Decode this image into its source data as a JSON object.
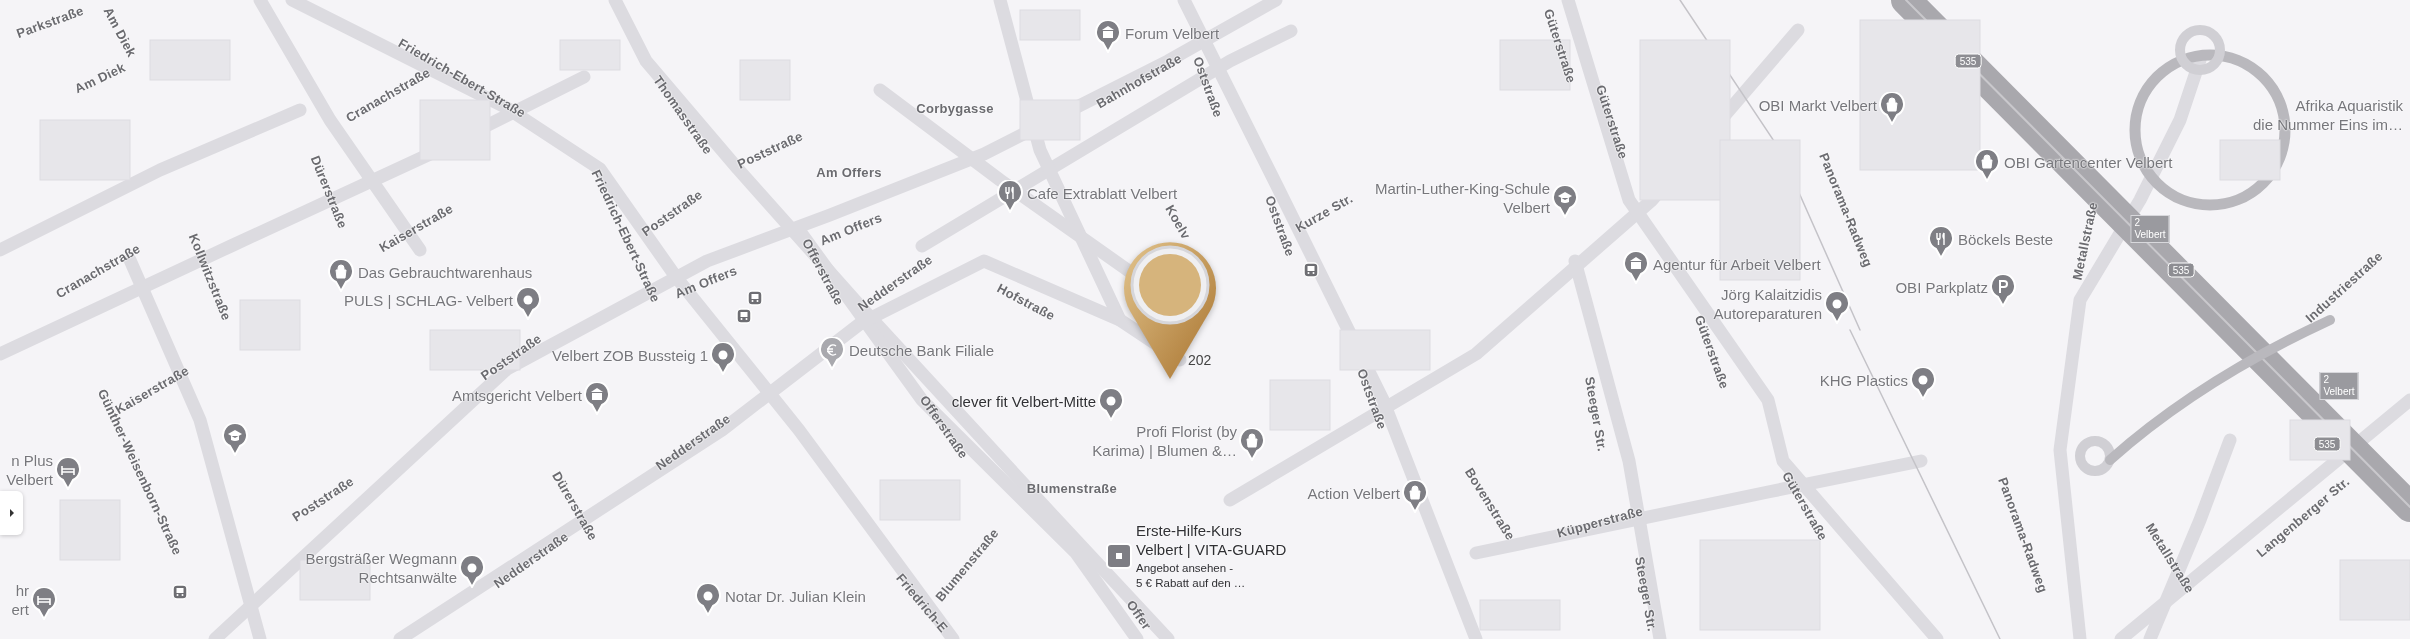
{
  "map": {
    "street_labels": [
      "Parkstraße",
      "Am Diek",
      "Am Diek",
      "Friedrich-Ebert-Straße",
      "Cranachstraße",
      "Cranachstraße",
      "Dürerstraße",
      "Kaiserstraße",
      "Kollwitzstraße",
      "Thomasstraße",
      "Poststraße",
      "Poststraße",
      "Friedrich-Ebert-Straße",
      "Am Offers",
      "Am Offers",
      "Am Offers",
      "Offerstraße",
      "Nedderstraße",
      "Hofstraße",
      "Koelv",
      "Bahnhofstraße",
      "Corbygasse",
      "Oststraße",
      "Oststraße",
      "Kurze Str.",
      "Oststraße",
      "Güterstraße",
      "Güterstraße",
      "Güterstraße",
      "Steeger Str.",
      "Steeger Str.",
      "Bovenstraße",
      "Küpperstraße",
      "Güterstraße",
      "Poststraße",
      "Kaiserstraße",
      "Günther-Weisenborn-Straße",
      "Poststraße",
      "Dürerstraße",
      "Nedderstraße",
      "Nedderstraße",
      "Blumenstraße",
      "Blumenstraße",
      "Offerstraße",
      "Friedrich-E",
      "Offer",
      "Panorama-Radweg",
      "Panorama-Radweg",
      "Metallstraße",
      "Metallstraße",
      "Industriestraße",
      "Langenberger Str."
    ],
    "places": [
      {
        "lines": [
          "Forum Velbert"
        ],
        "kind": "landmark",
        "highlighted": false
      },
      {
        "lines": [
          "OBI Markt Velbert"
        ],
        "kind": "shopping",
        "highlighted": false
      },
      {
        "lines": [
          "Afrika Aquaristik",
          "die Nummer Eins im…"
        ],
        "kind": "text",
        "highlighted": false
      },
      {
        "lines": [
          "OBI Gartencenter Velbert"
        ],
        "kind": "shopping",
        "highlighted": false
      },
      {
        "lines": [
          "Cafe Extrablatt Velbert"
        ],
        "kind": "restaurant",
        "highlighted": false
      },
      {
        "lines": [
          "Martin-Luther-King-Schule",
          "Velbert"
        ],
        "kind": "school",
        "highlighted": false
      },
      {
        "lines": [
          "Böckels Beste"
        ],
        "kind": "restaurant",
        "highlighted": false
      },
      {
        "lines": [
          "Agentur für Arbeit Velbert"
        ],
        "kind": "government",
        "highlighted": false
      },
      {
        "lines": [
          "OBI Parkplatz"
        ],
        "kind": "parking",
        "highlighted": false
      },
      {
        "lines": [
          "Jörg Kalaitzidis",
          "Autoreparaturen"
        ],
        "kind": "pin",
        "highlighted": false
      },
      {
        "lines": [
          "Das Gebrauchtwarenhaus"
        ],
        "kind": "shopping",
        "highlighted": false
      },
      {
        "lines": [
          "PULS | SCHLAG- Velbert"
        ],
        "kind": "pin",
        "highlighted": false
      },
      {
        "lines": [
          "Velbert ZOB Bussteig 1"
        ],
        "kind": "pin",
        "highlighted": false
      },
      {
        "lines": [
          "Deutsche Bank Filiale"
        ],
        "kind": "bank",
        "highlighted": false
      },
      {
        "lines": [
          "Amtsgericht Velbert"
        ],
        "kind": "government",
        "highlighted": false
      },
      {
        "lines": [
          "clever fit Velbert-Mitte"
        ],
        "kind": "pin",
        "highlighted": true
      },
      {
        "lines": [
          "KHG Plastics"
        ],
        "kind": "pin",
        "highlighted": false
      },
      {
        "lines": [
          "Profi Florist (by",
          "Karima) | Blumen &…"
        ],
        "kind": "shopping",
        "highlighted": false
      },
      {
        "lines": [
          "Action Velbert"
        ],
        "kind": "shopping",
        "highlighted": false
      },
      {
        "lines": [
          "Bergsträßer Wegmann",
          "Rechtsanwälte"
        ],
        "kind": "pin",
        "highlighted": false
      },
      {
        "lines": [
          "Erste-Hilfe-Kurs",
          "Velbert | VITA-GUARD"
        ],
        "note": [
          "Angebot ansehen -",
          "5 € Rabatt auf den …"
        ],
        "kind": "sponsored",
        "highlighted": true
      },
      {
        "lines": [
          "Notar Dr. Julian Klein"
        ],
        "kind": "pin",
        "highlighted": false
      },
      {
        "lines": [
          "n Plus",
          "Velbert"
        ],
        "kind": "hotel",
        "highlighted": false
      },
      {
        "lines": [
          "hr",
          "ert"
        ],
        "kind": "hotel",
        "highlighted": false
      }
    ],
    "location_marker": {
      "label": "202"
    },
    "route_shields": [
      "535",
      "535",
      "535"
    ],
    "exit_signs": [
      {
        "number": "2",
        "name": "Velbert"
      },
      {
        "number": "2",
        "name": "Velbert"
      }
    ]
  }
}
